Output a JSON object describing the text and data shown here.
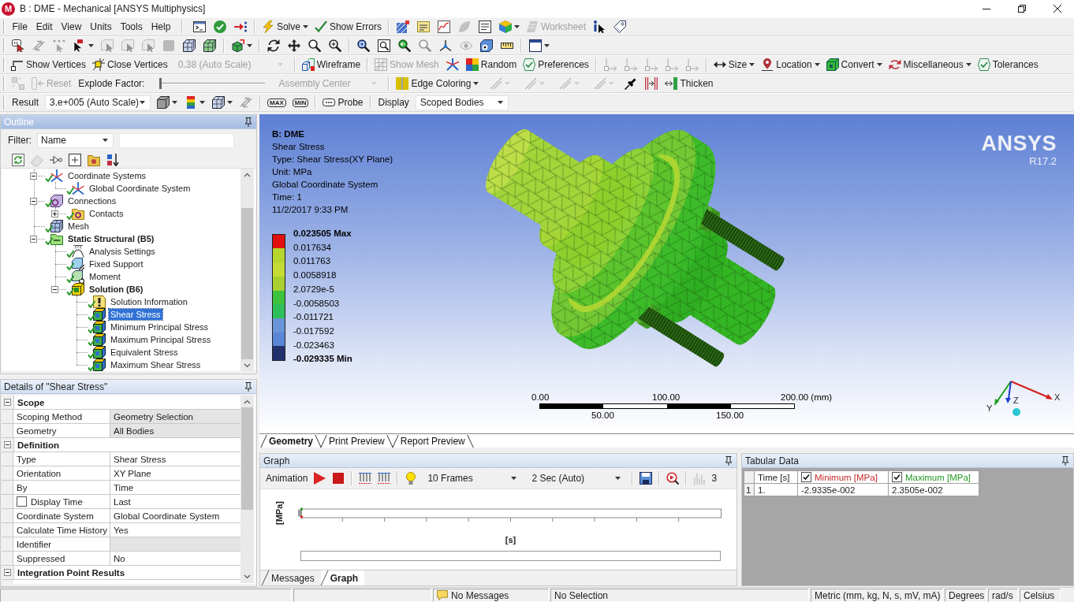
{
  "window": {
    "logo": "M",
    "title": "B : DME - Mechanical [ANSYS Multiphysics]"
  },
  "menu": [
    "File",
    "Edit",
    "View",
    "Units",
    "Tools",
    "Help"
  ],
  "toolbars": [
    {
      "groups": [
        [
          {
            "kind": "icon",
            "disabled": false
          },
          {
            "kind": "icon",
            "disabled": false
          },
          {
            "kind": "icon",
            "disabled": false
          }
        ],
        [
          {
            "kind": "button",
            "label": "Solve",
            "dropdown": true,
            "disabled": false
          },
          {
            "kind": "button",
            "label": "Show Errors",
            "disabled": false
          }
        ],
        [
          {
            "kind": "icon",
            "disabled": false
          },
          {
            "kind": "icon",
            "disabled": false
          },
          {
            "kind": "icon",
            "disabled": false
          },
          {
            "kind": "icon",
            "disabled": true
          },
          {
            "kind": "icon",
            "disabled": false
          },
          {
            "kind": "icon",
            "dropdown": true,
            "disabled": false
          },
          {
            "kind": "button",
            "label": "Worksheet",
            "disabled": true
          },
          {
            "kind": "icon",
            "disabled": false
          },
          {
            "kind": "icon",
            "disabled": false
          }
        ]
      ]
    },
    {
      "groups": [
        [
          {
            "kind": "icon",
            "disabled": false
          },
          {
            "kind": "icon",
            "disabled": true
          },
          {
            "kind": "icon",
            "disabled": true
          },
          {
            "kind": "icon",
            "dropdown": true,
            "disabled": false
          },
          {
            "kind": "icon",
            "disabled": true
          },
          {
            "kind": "icon",
            "disabled": true
          },
          {
            "kind": "icon",
            "disabled": true
          },
          {
            "kind": "icon",
            "disabled": true
          },
          {
            "kind": "icon",
            "disabled": false
          },
          {
            "kind": "icon",
            "disabled": false
          }
        ],
        [
          {
            "kind": "icon",
            "dropdown": true,
            "disabled": false
          }
        ],
        [
          {
            "kind": "icon",
            "disabled": false
          },
          {
            "kind": "icon",
            "disabled": false
          },
          {
            "kind": "icon",
            "disabled": false
          },
          {
            "kind": "icon",
            "disabled": false
          }
        ],
        [
          {
            "kind": "icon",
            "disabled": false
          },
          {
            "kind": "icon",
            "disabled": false
          },
          {
            "kind": "icon",
            "disabled": false
          },
          {
            "kind": "icon",
            "disabled": true
          },
          {
            "kind": "icon",
            "disabled": false
          },
          {
            "kind": "icon",
            "disabled": true
          },
          {
            "kind": "icon",
            "disabled": false
          },
          {
            "kind": "icon",
            "disabled": false
          }
        ],
        [
          {
            "kind": "icon",
            "dropdown": true,
            "disabled": false
          }
        ]
      ]
    },
    {
      "groups": [
        [
          {
            "kind": "button",
            "label": "Show Vertices",
            "disabled": false
          },
          {
            "kind": "button",
            "label": "Close Vertices",
            "disabled": false
          },
          {
            "kind": "combo",
            "value": "0.38 (Auto Scale)",
            "disabled": true
          }
        ],
        [
          {
            "kind": "button",
            "label": "Wireframe",
            "disabled": false
          }
        ],
        [
          {
            "kind": "button",
            "label": "Show Mesh",
            "disabled": true
          },
          {
            "kind": "icon",
            "disabled": false
          },
          {
            "kind": "button",
            "label": "Random",
            "disabled": false
          },
          {
            "kind": "button",
            "label": "Preferences",
            "disabled": false
          }
        ],
        [
          {
            "kind": "icon",
            "disabled": true
          },
          {
            "kind": "icon",
            "disabled": true
          },
          {
            "kind": "icon",
            "disabled": true
          },
          {
            "kind": "icon",
            "disabled": true
          },
          {
            "kind": "icon",
            "disabled": true
          }
        ],
        [
          {
            "kind": "button",
            "label": "Size",
            "dropdown": true,
            "disabled": false
          },
          {
            "kind": "button",
            "label": "Location",
            "dropdown": true,
            "disabled": false
          },
          {
            "kind": "button",
            "label": "Convert",
            "dropdown": true,
            "disabled": false
          },
          {
            "kind": "button",
            "label": "Miscellaneous",
            "dropdown": true,
            "disabled": false
          },
          {
            "kind": "button",
            "label": "Tolerances",
            "disabled": false
          }
        ]
      ]
    },
    {
      "groups": [
        [
          {
            "kind": "icon",
            "disabled": true
          },
          {
            "kind": "button",
            "label": "Reset",
            "disabled": true
          },
          {
            "kind": "label",
            "label": "Explode Factor:"
          },
          {
            "kind": "slider",
            "level": 0
          },
          {
            "kind": "combo",
            "value": "Assembly Center",
            "disabled": true
          }
        ],
        [
          {
            "kind": "button",
            "label": "Edge Coloring",
            "dropdown": true,
            "disabled": false
          },
          {
            "kind": "icon",
            "dropdown": true,
            "disabled": true
          },
          {
            "kind": "icon",
            "dropdown": true,
            "disabled": true
          },
          {
            "kind": "icon",
            "dropdown": true,
            "disabled": true
          },
          {
            "kind": "icon",
            "dropdown": true,
            "disabled": true
          },
          {
            "kind": "icon",
            "disabled": false
          },
          {
            "kind": "icon",
            "disabled": false
          },
          {
            "kind": "button",
            "label": "Thicken",
            "disabled": false
          }
        ]
      ]
    },
    {
      "groups": [
        [
          {
            "kind": "label",
            "label": "Result"
          },
          {
            "kind": "combo",
            "value": "3.e+005 (Auto Scale)",
            "disabled": false
          },
          {
            "kind": "icon",
            "dropdown": true,
            "disabled": false
          },
          {
            "kind": "icon",
            "dropdown": true,
            "disabled": false
          },
          {
            "kind": "icon",
            "dropdown": true,
            "disabled": false
          },
          {
            "kind": "icon",
            "disabled": true
          }
        ],
        [
          {
            "kind": "tag",
            "label": "MAX",
            "disabled": false
          },
          {
            "kind": "tag",
            "label": "MIN",
            "disabled": false
          }
        ],
        [
          {
            "kind": "button",
            "label": "Probe",
            "disabled": false
          }
        ],
        [
          {
            "kind": "label",
            "label": "Display"
          },
          {
            "kind": "combo",
            "value": "Scoped Bodies",
            "disabled": false
          }
        ]
      ]
    }
  ],
  "outline": {
    "title": "Outline",
    "active": true,
    "filter": {
      "label": "Filter:",
      "value": "Name"
    },
    "toolbar": [
      {
        "disabled": false
      },
      {
        "disabled": true
      },
      {
        "disabled": false
      },
      {
        "disabled": false
      },
      {
        "disabled": false
      },
      {
        "disabled": false
      }
    ],
    "tree": [
      {
        "label": "Coordinate Systems",
        "kind": "axes",
        "solved": true,
        "expanded": true,
        "selected": false,
        "children": [
          {
            "label": "Global Coordinate System",
            "kind": "axes",
            "solved": true,
            "selected": false
          }
        ]
      },
      {
        "label": "Connections",
        "kind": "connection",
        "solved": true,
        "expanded": true,
        "selected": false,
        "children": [
          {
            "label": "Contacts",
            "kind": "contacts",
            "solved": true,
            "expanded": false,
            "selected": false
          }
        ]
      },
      {
        "label": "Mesh",
        "kind": "mesh",
        "solved": true,
        "selected": false
      },
      {
        "label": "Static Structural (B5)",
        "kind": "environment",
        "solved": true,
        "expanded": true,
        "bold": true,
        "selected": false,
        "children": [
          {
            "label": "Analysis Settings",
            "kind": "settings",
            "solved": true,
            "selected": false
          },
          {
            "label": "Fixed Support",
            "kind": "support",
            "solved": true,
            "selected": false
          },
          {
            "label": "Moment",
            "kind": "moment",
            "solved": true,
            "selected": false
          },
          {
            "label": "Solution (B6)",
            "kind": "solution",
            "solved": true,
            "expanded": true,
            "bold": true,
            "selected": false,
            "children": [
              {
                "label": "Solution Information",
                "kind": "info",
                "solved": true,
                "selected": false
              },
              {
                "label": "Shear Stress",
                "kind": "result",
                "solved": true,
                "selected": true
              },
              {
                "label": "Minimum Principal Stress",
                "kind": "result",
                "solved": true,
                "selected": false
              },
              {
                "label": "Maximum Principal Stress",
                "kind": "result",
                "solved": true,
                "selected": false
              },
              {
                "label": "Equivalent Stress",
                "kind": "result",
                "solved": true,
                "selected": false
              },
              {
                "label": "Maximum Shear Stress",
                "kind": "result",
                "solved": true,
                "selected": false
              }
            ]
          }
        ]
      }
    ]
  },
  "details": {
    "title": "Details of \"Shear Stress\"",
    "active": false,
    "groups": [
      {
        "label": "Scope",
        "expanded": true,
        "rows": [
          {
            "name": "Scoping Method",
            "value": "Geometry Selection",
            "shaded": true
          },
          {
            "name": "Geometry",
            "value": "All Bodies",
            "shaded": true
          }
        ]
      },
      {
        "label": "Definition",
        "expanded": true,
        "rows": [
          {
            "name": "Type",
            "value": "Shear Stress",
            "shaded": false
          },
          {
            "name": "Orientation",
            "value": "XY Plane",
            "shaded": false
          },
          {
            "name": "By",
            "value": "Time",
            "shaded": false
          },
          {
            "name": "Display Time",
            "value": "Last",
            "shaded": false,
            "checked": false
          },
          {
            "name": "Coordinate System",
            "value": "Global Coordinate System",
            "shaded": false
          },
          {
            "name": "Calculate Time History",
            "value": "Yes",
            "shaded": false
          },
          {
            "name": "Identifier",
            "shaded": true
          },
          {
            "name": "Suppressed",
            "value": "No",
            "shaded": false
          }
        ]
      },
      {
        "label": "Integration Point Results",
        "expanded": true
      }
    ]
  },
  "viewport": {
    "info": {
      "title": "B: DME",
      "lines": [
        "Shear Stress",
        "Type: Shear Stress(XY Plane)",
        "Unit: MPa",
        "Global Coordinate System",
        "Time: 1",
        "11/2/2017 9:33 PM"
      ]
    },
    "legend": {
      "labels": [
        {
          "text": "0.023505 Max",
          "bold": true
        },
        {
          "text": "0.017634",
          "bold": false
        },
        {
          "text": "0.011763",
          "bold": false
        },
        {
          "text": "0.0058918",
          "bold": false
        },
        {
          "text": "2.0729e-5",
          "bold": false
        },
        {
          "text": "-0.0058503",
          "bold": false
        },
        {
          "text": "-0.011721",
          "bold": false
        },
        {
          "text": "-0.017592",
          "bold": false
        },
        {
          "text": "-0.023463",
          "bold": false
        },
        {
          "text": "-0.029335 Min",
          "bold": true
        }
      ],
      "bands": [
        {
          "color": "#e01010"
        },
        {
          "color": "#b4d62e"
        },
        {
          "color": "#c4dc34"
        },
        {
          "color": "#a8d030"
        },
        {
          "color": "#3cc23c"
        },
        {
          "color": "#2fbf5a"
        },
        {
          "color": "#6a94d8"
        },
        {
          "color": "#5a86d6"
        },
        {
          "color": "#22306e"
        }
      ]
    },
    "logo": {
      "name": "ANSYS",
      "version": "R17.2"
    },
    "scale_bar": {
      "top_labels": [
        "0.00",
        "100.00",
        "200.00 (mm)"
      ],
      "bottom_labels": [
        "50.00",
        "150.00"
      ]
    },
    "triad": {
      "x": "X",
      "y": "Y",
      "z": "Z"
    },
    "tabs": [
      {
        "label": "Geometry",
        "selected": true
      },
      {
        "label": "Print Preview",
        "selected": false
      },
      {
        "label": "Report Preview",
        "selected": false
      }
    ]
  },
  "graph": {
    "title": "Graph",
    "active": false,
    "toolbar": {
      "groups": [
        [
          {
            "kind": "label",
            "label": "Animation"
          },
          {
            "kind": "icon",
            "disabled": false
          },
          {
            "kind": "icon",
            "disabled": false
          }
        ],
        [
          {
            "kind": "icon",
            "disabled": false
          },
          {
            "kind": "icon",
            "disabled": false
          }
        ],
        [
          {
            "kind": "icon",
            "disabled": false
          },
          {
            "kind": "combo",
            "value": "10 Frames",
            "disabled": false
          },
          {
            "kind": "combo",
            "value": "2 Sec (Auto)",
            "disabled": false
          }
        ],
        [
          {
            "kind": "icon",
            "disabled": false
          }
        ],
        [
          {
            "kind": "icon",
            "disabled": false
          }
        ],
        [
          {
            "kind": "icon",
            "disabled": true
          },
          {
            "kind": "label",
            "label": "3"
          }
        ]
      ]
    },
    "ylabel": "[MPa]",
    "xlabel": "[s]",
    "tabs": [
      {
        "label": "Messages",
        "selected": false
      },
      {
        "label": "Graph",
        "selected": true
      }
    ]
  },
  "tabular": {
    "title": "Tabular Data",
    "active": false,
    "columns": [
      {
        "label": "Time [s]"
      },
      {
        "label": "Minimum [MPa]",
        "checked": true,
        "color": "#c42b2b"
      },
      {
        "label": "Maximum [MPa]",
        "checked": true,
        "color": "#239a23"
      }
    ],
    "rows": [
      {
        "index": "1",
        "cells": [
          "1.",
          "-2.9335e-002",
          "2.3505e-002"
        ]
      }
    ]
  },
  "status_bar": {
    "messages": "No Messages",
    "selection": "No Selection",
    "units": "Metric (mm, kg, N, s, mV, mA)",
    "angle": "Degrees",
    "angular_velocity": "rad/s",
    "temperature": "Celsius"
  }
}
